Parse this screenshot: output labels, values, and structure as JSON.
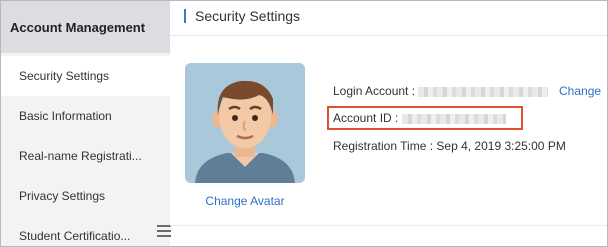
{
  "sidebar": {
    "title": "Account Management",
    "items": [
      {
        "label": "Security Settings",
        "active": true
      },
      {
        "label": "Basic Information",
        "active": false
      },
      {
        "label": "Real-name Registrati...",
        "active": false
      },
      {
        "label": "Privacy Settings",
        "active": false
      },
      {
        "label": "Student Certificatio...",
        "active": false
      }
    ],
    "collapse_icon": "menu-icon"
  },
  "main": {
    "title": "Security Settings",
    "avatar": {
      "change_label": "Change Avatar",
      "background": "#a9c8da"
    },
    "login_account": {
      "label": "Login Account :",
      "change_label": "Change"
    },
    "account_id": {
      "label": "Account ID :"
    },
    "registration": {
      "label": "Registration Time :",
      "value": "Sep 4, 2019 3:25:00 PM"
    }
  },
  "colors": {
    "accent": "#2f7ad6",
    "link": "#2f6fc4",
    "highlight": "#e24f2f"
  }
}
